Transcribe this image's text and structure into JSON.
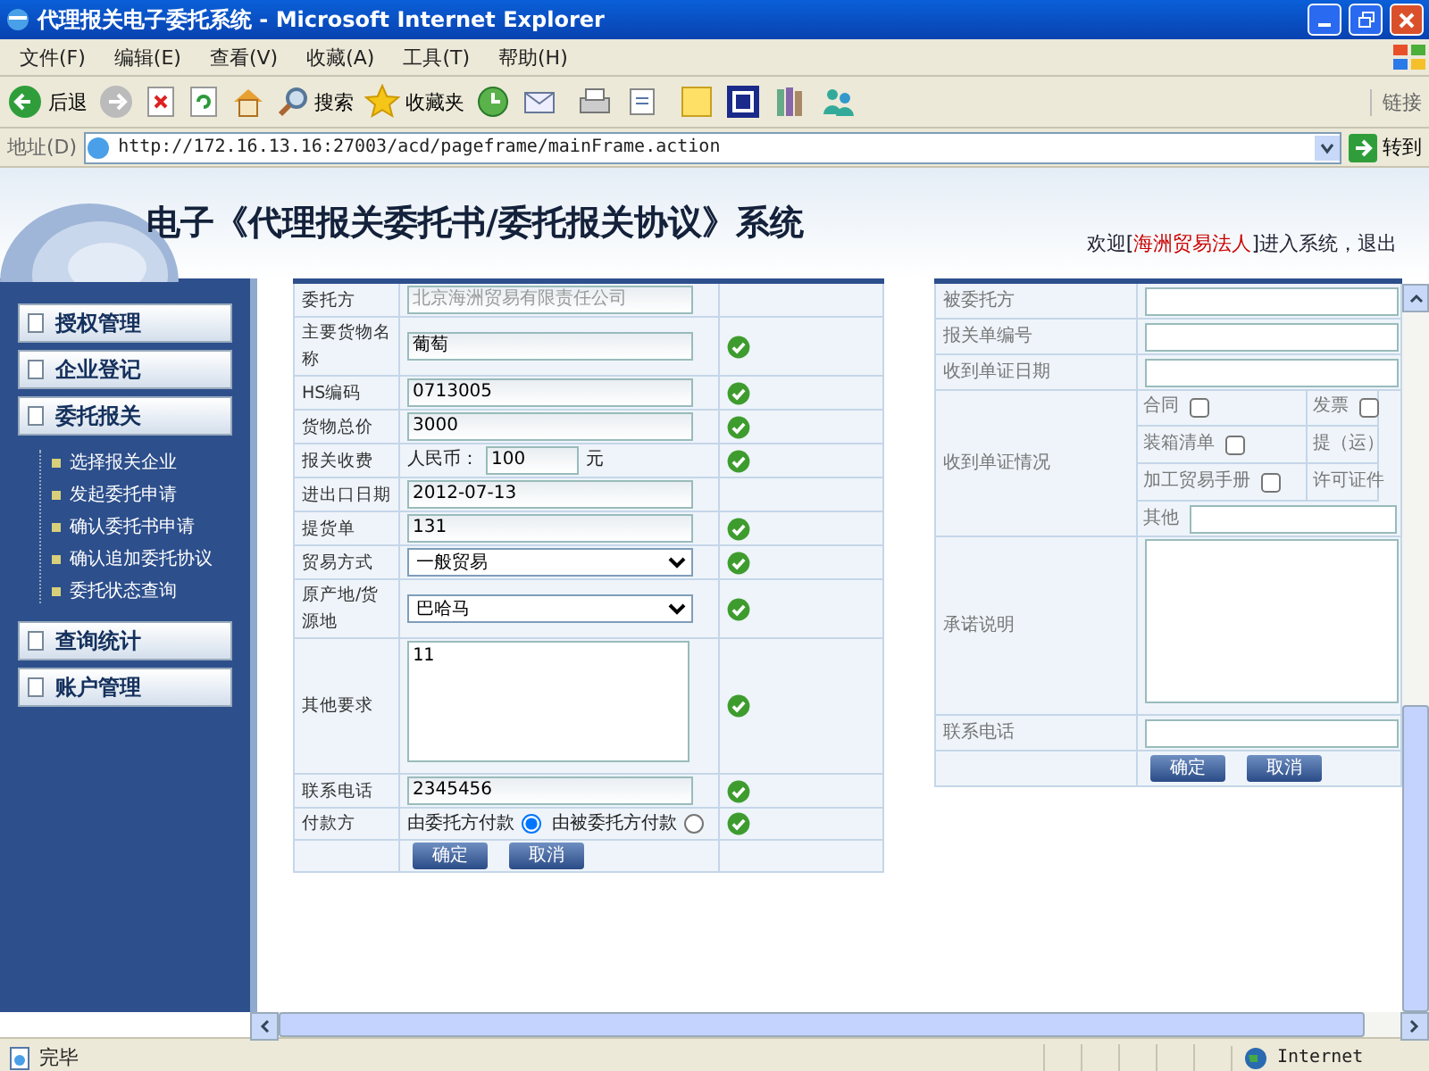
{
  "window": {
    "title": "代理报关电子委托系统 - Microsoft Internet Explorer"
  },
  "menu": [
    "文件(F)",
    "编辑(E)",
    "查看(V)",
    "收藏(A)",
    "工具(T)",
    "帮助(H)"
  ],
  "toolbar": {
    "back": "后退",
    "search": "搜索",
    "favorites": "收藏夹",
    "links": "链接"
  },
  "address": {
    "label": "地址(D)",
    "url": "http://172.16.13.16:27003/acd/pageframe/mainFrame.action",
    "go": "转到"
  },
  "header": {
    "title": "电子《代理报关委托书/委托报关协议》系统",
    "welcome": "欢迎[",
    "user": "海洲贸易法人",
    "entered": "]进入系统，",
    "logout": "退出"
  },
  "sidebar": [
    {
      "label": "授权管理"
    },
    {
      "label": "企业登记"
    },
    {
      "label": "委托报关",
      "children": [
        {
          "label": "选择报关企业"
        },
        {
          "label": "发起委托申请"
        },
        {
          "label": "确认委托书申请"
        },
        {
          "label": "确认追加委托协议"
        },
        {
          "label": "委托状态查询"
        }
      ]
    },
    {
      "label": "查询统计"
    },
    {
      "label": "账户管理"
    }
  ],
  "left_form": {
    "rows": [
      {
        "kind": "input",
        "label": "委托方",
        "value": "北京海洲贸易有限责任公司",
        "disabled": true,
        "valid": false
      },
      {
        "kind": "input",
        "label": "主要货物名称",
        "value": "葡萄",
        "disabled": false,
        "valid": true
      },
      {
        "kind": "input",
        "label": "HS编码",
        "value": "0713005",
        "disabled": false,
        "valid": true
      },
      {
        "kind": "input",
        "label": "货物总价",
        "value": "3000",
        "disabled": false,
        "valid": true
      },
      {
        "kind": "fee",
        "label": "报关收费",
        "prefix": "人民币：",
        "value": "100",
        "suffix": "元",
        "valid": true
      },
      {
        "kind": "input",
        "label": "进出口日期",
        "value": "2012-07-13",
        "disabled": false,
        "valid": false
      },
      {
        "kind": "input",
        "label": "提货单",
        "value": "131",
        "disabled": false,
        "valid": true
      },
      {
        "kind": "select",
        "label": "贸易方式",
        "value": "一般贸易",
        "valid": true
      },
      {
        "kind": "select",
        "label": "原产地/货源地",
        "value": "巴哈马",
        "valid": true
      },
      {
        "kind": "textarea",
        "label": "其他要求",
        "value": "11",
        "valid": true
      },
      {
        "kind": "input",
        "label": "联系电话",
        "value": "2345456",
        "disabled": false,
        "valid": true
      },
      {
        "kind": "radio",
        "label": "付款方",
        "options": [
          {
            "label": "由委托方付款",
            "selected": true
          },
          {
            "label": "由被委托方付款",
            "selected": false
          }
        ],
        "valid": true
      }
    ],
    "buttons": [
      "确定",
      "取消"
    ]
  },
  "right_form": {
    "rows": [
      {
        "kind": "input",
        "label": "被委托方"
      },
      {
        "kind": "input",
        "label": "报关单编号"
      },
      {
        "kind": "input",
        "label": "收到单证日期"
      },
      {
        "kind": "checks",
        "label": "收到单证情况",
        "items": [
          {
            "label": "合同",
            "checked": false
          },
          {
            "label": "发票",
            "checked": false
          },
          {
            "label": "装箱清单",
            "checked": false
          },
          {
            "label": "提（运）"
          },
          {
            "label": "加工贸易手册",
            "checked": false
          },
          {
            "label": "许可证件"
          }
        ],
        "other": "其他"
      },
      {
        "kind": "textarea",
        "label": "承诺说明"
      },
      {
        "kind": "input",
        "label": "联系电话"
      }
    ],
    "buttons": [
      "确定",
      "取消"
    ]
  },
  "status_bar": {
    "text": "完毕",
    "zone": "Internet"
  }
}
